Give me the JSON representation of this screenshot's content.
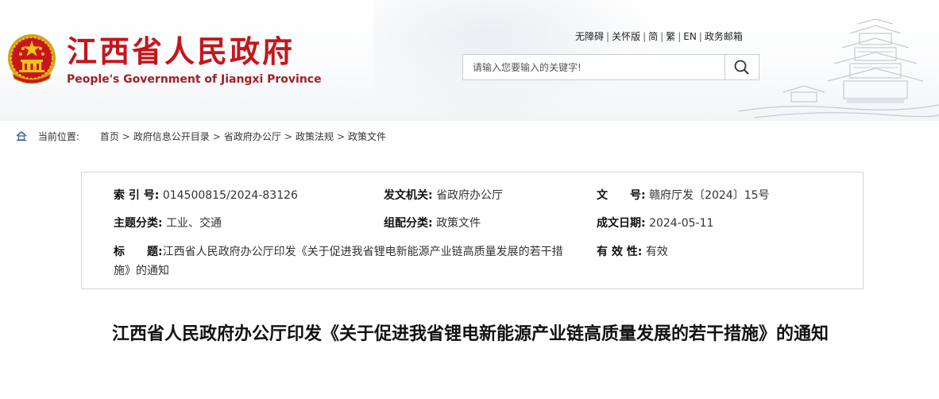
{
  "site": {
    "name_cn": "江西省人民政府",
    "name_en": "People's Government of Jiangxi Province"
  },
  "top_links": [
    "无障碍",
    "关怀版",
    "简",
    "繁",
    "EN",
    "政务邮箱"
  ],
  "search": {
    "placeholder": "请输入您要输入的关键字!"
  },
  "breadcrumb": {
    "label": "当前位置:",
    "items": [
      "首页",
      "政府信息公开目录",
      "省政府办公厅",
      "政策法规",
      "政策文件"
    ]
  },
  "meta": {
    "index_key": "索 引 号:",
    "index_val": "014500815/2024-83126",
    "issuer_key": "发文机关:",
    "issuer_val": "省政府办公厅",
    "docno_key": "文　　号:",
    "docno_val": "赣府厅发〔2024〕15号",
    "topic_key": "主题分类:",
    "topic_val": "工业、交通",
    "category_key": "组配分类:",
    "category_val": "政策文件",
    "date_key": "成文日期:",
    "date_val": "2024-05-11",
    "title_key": "标　　题:",
    "title_val": "江西省人民政府办公厅印发《关于促进我省锂电新能源产业链高质量发展的若干措施》的通知",
    "validity_key": "有 效 性:",
    "validity_val": "有效"
  },
  "article": {
    "title": "江西省人民政府办公厅印发《关于促进我省锂电新能源产业链高质量发展的若干措施》的通知"
  },
  "colors": {
    "brand_red": "#c4161c",
    "emblem_gold": "#f2c200"
  },
  "icons": [
    "national-emblem-icon",
    "search-icon",
    "home-icon",
    "pagoda-illustration"
  ]
}
